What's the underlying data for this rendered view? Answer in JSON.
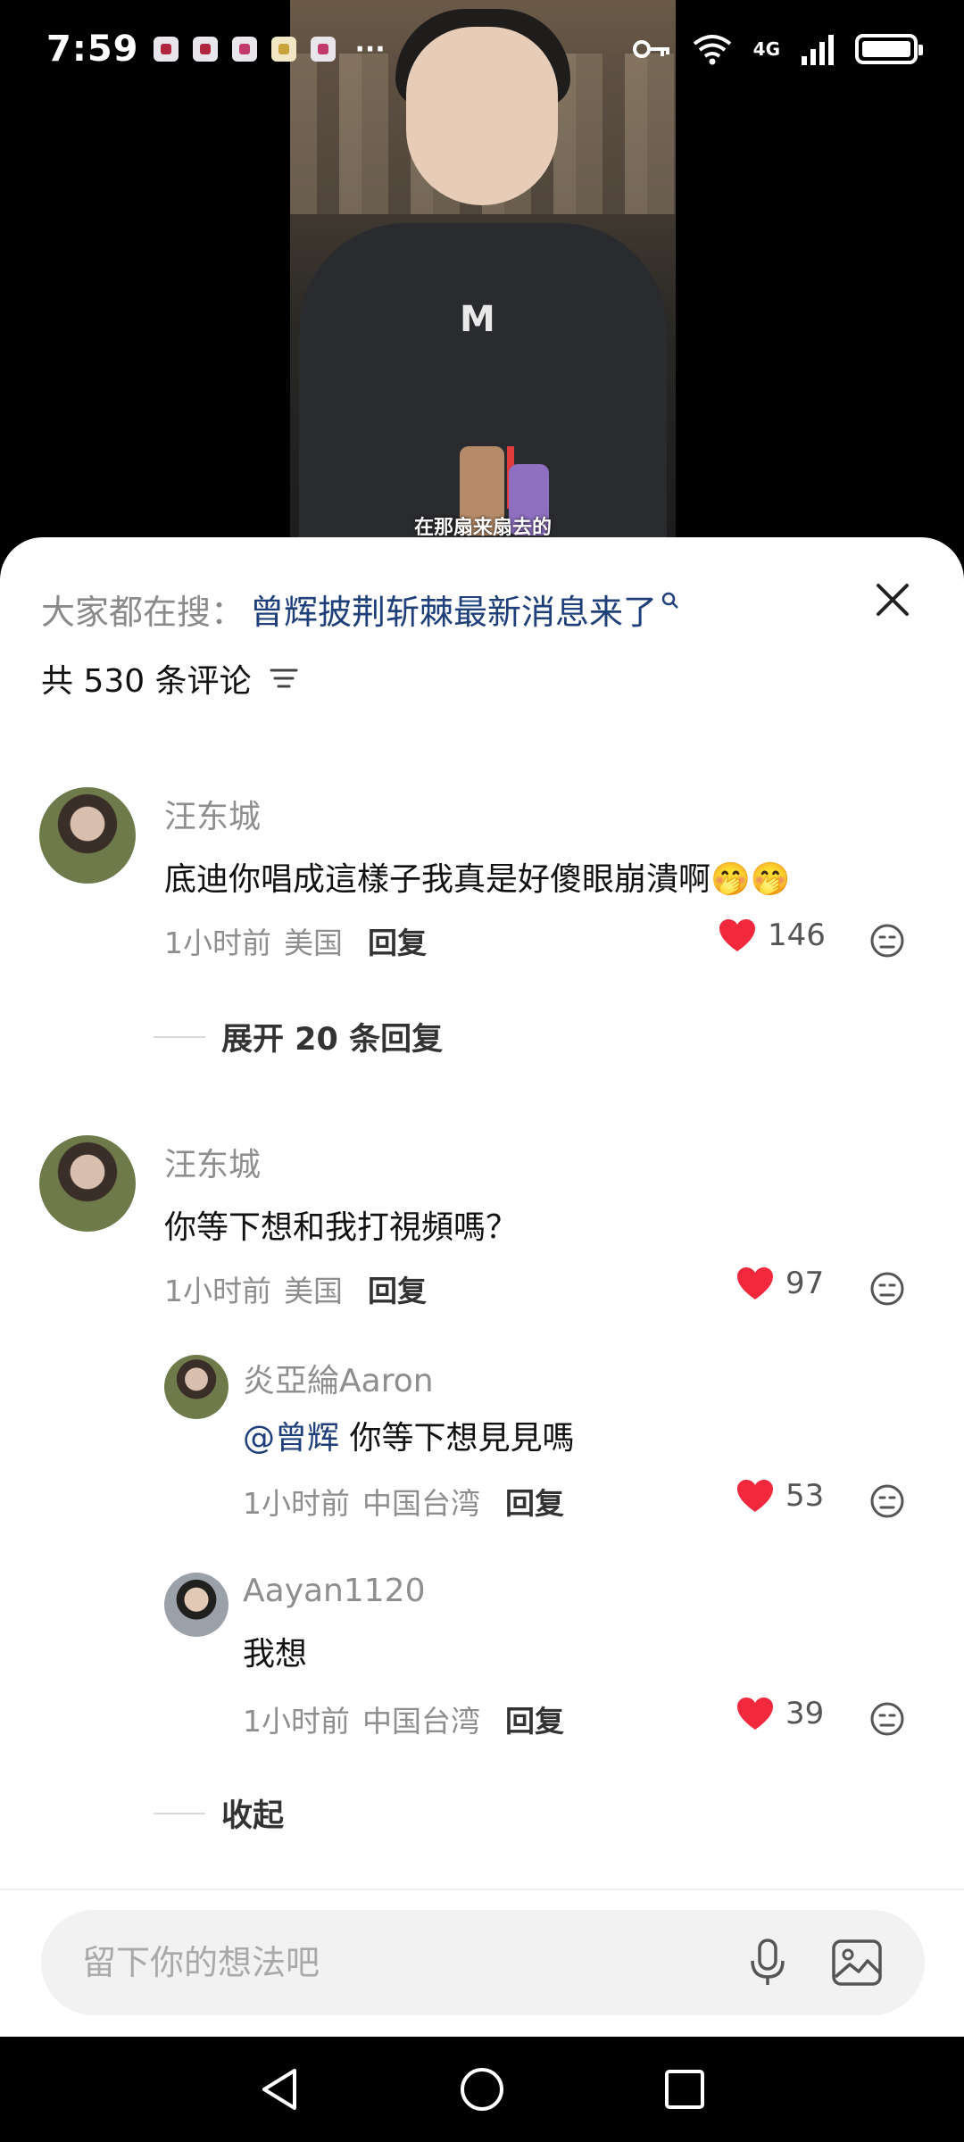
{
  "status_bar": {
    "time": "7:59",
    "network": "4G",
    "more": "···"
  },
  "video": {
    "subtitle": "在那扇来扇去的",
    "shirt_logo": "M"
  },
  "search_bar": {
    "prefix": "大家都在搜：",
    "query": "曾辉披荆斩棘最新消息来了"
  },
  "comments_header": {
    "count_label": "共 530 条评论"
  },
  "comments": [
    {
      "user": "汪东城",
      "text": "底迪你唱成這樣子我真是好傻眼崩潰啊🤭🤭",
      "time": "1小时前",
      "location": "美国",
      "reply_label": "回复",
      "likes": "146"
    },
    {
      "user": "汪东城",
      "text": "你等下想和我打視頻嗎？",
      "time": "1小时前",
      "location": "美国",
      "reply_label": "回复",
      "likes": "97"
    }
  ],
  "expand_replies_label": "展开 20 条回复",
  "replies": [
    {
      "user": "炎亞綸Aaron",
      "mention": "@曾辉",
      "text": " 你等下想見見嗎",
      "time": "1小时前",
      "location": "中国台湾",
      "reply_label": "回复",
      "likes": "53"
    },
    {
      "user": "Aayan1120",
      "text": "我想",
      "time": "1小时前",
      "location": "中国台湾",
      "reply_label": "回复",
      "likes": "39"
    }
  ],
  "collapse_label": "收起",
  "input": {
    "placeholder": "留下你的想法吧"
  },
  "colors": {
    "heart": "#f2283d",
    "link": "#1f3f7a",
    "meta_gray": "#8e8e8e"
  }
}
